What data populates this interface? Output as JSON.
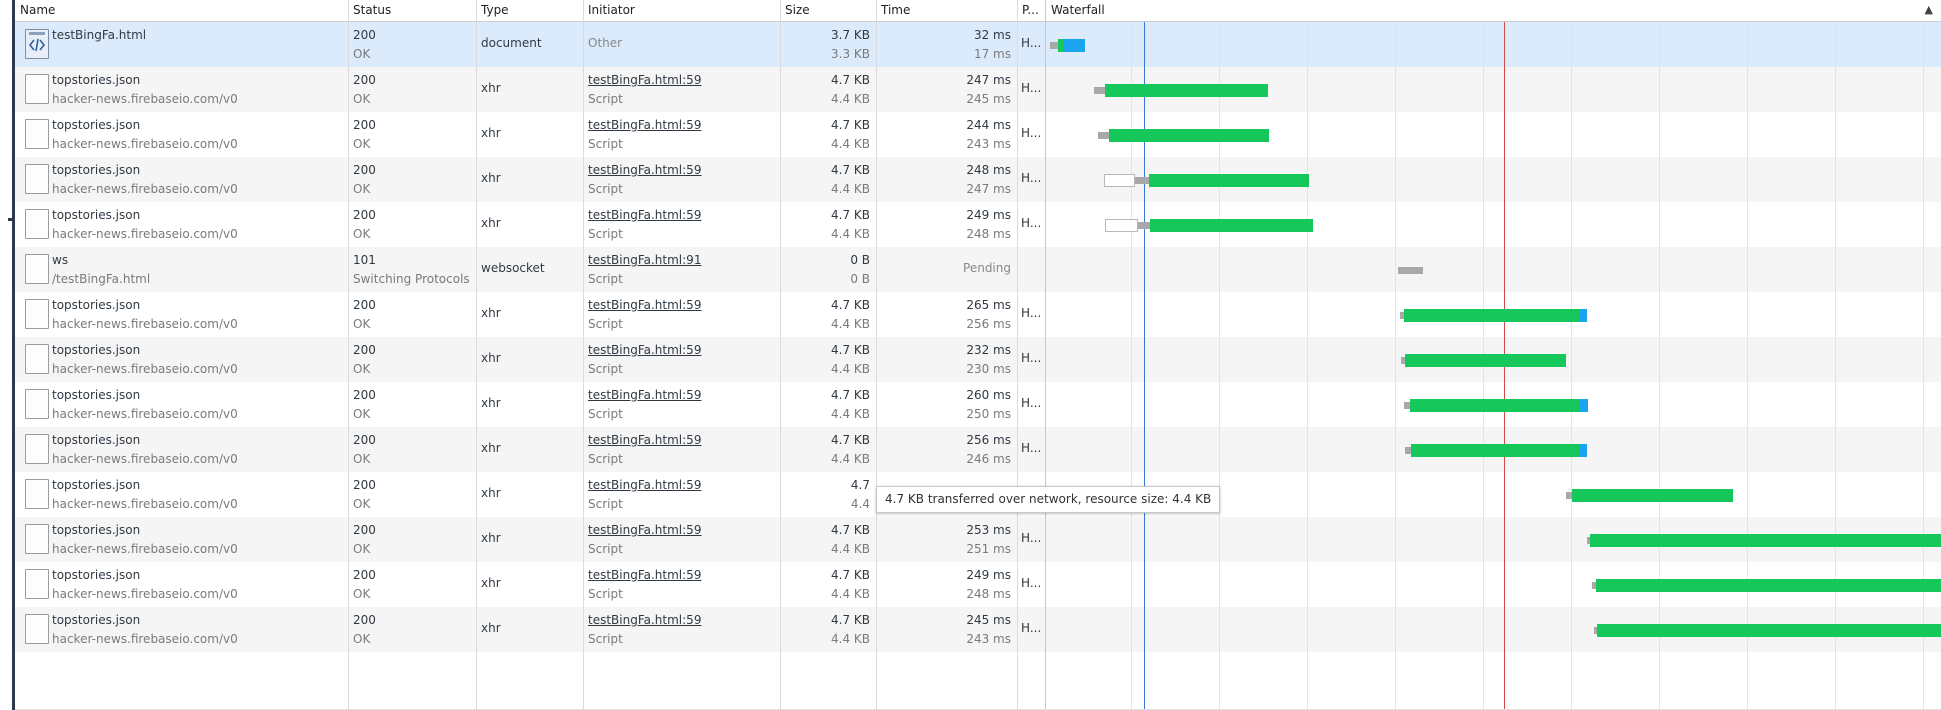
{
  "columns": {
    "name": "Name",
    "status": "Status",
    "type": "Type",
    "initiator": "Initiator",
    "size": "Size",
    "time": "Time",
    "protocol": "P...",
    "waterfall": "Waterfall"
  },
  "sort_indicator": "▲",
  "tooltip": "4.7 KB transferred over network, resource size: 4.4 KB",
  "requests": [
    {
      "name": "testBingFa.html",
      "path": "",
      "status": "200",
      "status_text": "OK",
      "type": "document",
      "initiator": "Other",
      "initiator_sub": "",
      "size": "3.7 KB",
      "resource_size": "3.3 KB",
      "time": "32 ms",
      "latency": "17 ms",
      "protocol": "H...",
      "icon": "html-file-icon"
    },
    {
      "name": "topstories.json",
      "path": "hacker-news.firebaseio.com/v0",
      "status": "200",
      "status_text": "OK",
      "type": "xhr",
      "initiator": "testBingFa.html:59",
      "initiator_sub": "Script",
      "size": "4.7 KB",
      "resource_size": "4.4 KB",
      "time": "247 ms",
      "latency": "245 ms",
      "protocol": "H...",
      "icon": "file-icon"
    },
    {
      "name": "topstories.json",
      "path": "hacker-news.firebaseio.com/v0",
      "status": "200",
      "status_text": "OK",
      "type": "xhr",
      "initiator": "testBingFa.html:59",
      "initiator_sub": "Script",
      "size": "4.7 KB",
      "resource_size": "4.4 KB",
      "time": "244 ms",
      "latency": "243 ms",
      "protocol": "H...",
      "icon": "file-icon"
    },
    {
      "name": "topstories.json",
      "path": "hacker-news.firebaseio.com/v0",
      "status": "200",
      "status_text": "OK",
      "type": "xhr",
      "initiator": "testBingFa.html:59",
      "initiator_sub": "Script",
      "size": "4.7 KB",
      "resource_size": "4.4 KB",
      "time": "248 ms",
      "latency": "247 ms",
      "protocol": "H...",
      "icon": "file-icon"
    },
    {
      "name": "topstories.json",
      "path": "hacker-news.firebaseio.com/v0",
      "status": "200",
      "status_text": "OK",
      "type": "xhr",
      "initiator": "testBingFa.html:59",
      "initiator_sub": "Script",
      "size": "4.7 KB",
      "resource_size": "4.4 KB",
      "time": "249 ms",
      "latency": "248 ms",
      "protocol": "H...",
      "icon": "file-icon"
    },
    {
      "name": "ws",
      "path": "/testBingFa.html",
      "status": "101",
      "status_text": "Switching Protocols",
      "type": "websocket",
      "initiator": "testBingFa.html:91",
      "initiator_sub": "Script",
      "size": "0 B",
      "resource_size": "0 B",
      "time": "Pending",
      "latency": "",
      "protocol": "",
      "icon": "file-icon"
    },
    {
      "name": "topstories.json",
      "path": "hacker-news.firebaseio.com/v0",
      "status": "200",
      "status_text": "OK",
      "type": "xhr",
      "initiator": "testBingFa.html:59",
      "initiator_sub": "Script",
      "size": "4.7 KB",
      "resource_size": "4.4 KB",
      "time": "265 ms",
      "latency": "256 ms",
      "protocol": "H...",
      "icon": "file-icon"
    },
    {
      "name": "topstories.json",
      "path": "hacker-news.firebaseio.com/v0",
      "status": "200",
      "status_text": "OK",
      "type": "xhr",
      "initiator": "testBingFa.html:59",
      "initiator_sub": "Script",
      "size": "4.7 KB",
      "resource_size": "4.4 KB",
      "time": "232 ms",
      "latency": "230 ms",
      "protocol": "H...",
      "icon": "file-icon"
    },
    {
      "name": "topstories.json",
      "path": "hacker-news.firebaseio.com/v0",
      "status": "200",
      "status_text": "OK",
      "type": "xhr",
      "initiator": "testBingFa.html:59",
      "initiator_sub": "Script",
      "size": "4.7 KB",
      "resource_size": "4.4 KB",
      "time": "260 ms",
      "latency": "250 ms",
      "protocol": "H...",
      "icon": "file-icon"
    },
    {
      "name": "topstories.json",
      "path": "hacker-news.firebaseio.com/v0",
      "status": "200",
      "status_text": "OK",
      "type": "xhr",
      "initiator": "testBingFa.html:59",
      "initiator_sub": "Script",
      "size": "4.7 KB",
      "resource_size": "4.4 KB",
      "time": "256 ms",
      "latency": "246 ms",
      "protocol": "H...",
      "icon": "file-icon"
    },
    {
      "name": "topstories.json",
      "path": "hacker-news.firebaseio.com/v0",
      "status": "200",
      "status_text": "OK",
      "type": "xhr",
      "initiator": "testBingFa.html:59",
      "initiator_sub": "Script",
      "size": "4.7",
      "resource_size": "4.4",
      "time": "",
      "latency": "",
      "protocol": "",
      "icon": "file-icon"
    },
    {
      "name": "topstories.json",
      "path": "hacker-news.firebaseio.com/v0",
      "status": "200",
      "status_text": "OK",
      "type": "xhr",
      "initiator": "testBingFa.html:59",
      "initiator_sub": "Script",
      "size": "4.7 KB",
      "resource_size": "4.4 KB",
      "time": "253 ms",
      "latency": "251 ms",
      "protocol": "H...",
      "icon": "file-icon"
    },
    {
      "name": "topstories.json",
      "path": "hacker-news.firebaseio.com/v0",
      "status": "200",
      "status_text": "OK",
      "type": "xhr",
      "initiator": "testBingFa.html:59",
      "initiator_sub": "Script",
      "size": "4.7 KB",
      "resource_size": "4.4 KB",
      "time": "249 ms",
      "latency": "248 ms",
      "protocol": "H...",
      "icon": "file-icon"
    },
    {
      "name": "topstories.json",
      "path": "hacker-news.firebaseio.com/v0",
      "status": "200",
      "status_text": "OK",
      "type": "xhr",
      "initiator": "testBingFa.html:59",
      "initiator_sub": "Script",
      "size": "4.7 KB",
      "resource_size": "4.4 KB",
      "time": "245 ms",
      "latency": "243 ms",
      "protocol": "H...",
      "icon": "file-icon"
    }
  ],
  "colors": {
    "waiting": "#16c75b",
    "download": "#1aa3ef",
    "stalled": "#a8a8a8",
    "dom_content_loaded": "#3a78d8",
    "load": "#d44a4a",
    "selected_row": "#dcebfc"
  }
}
